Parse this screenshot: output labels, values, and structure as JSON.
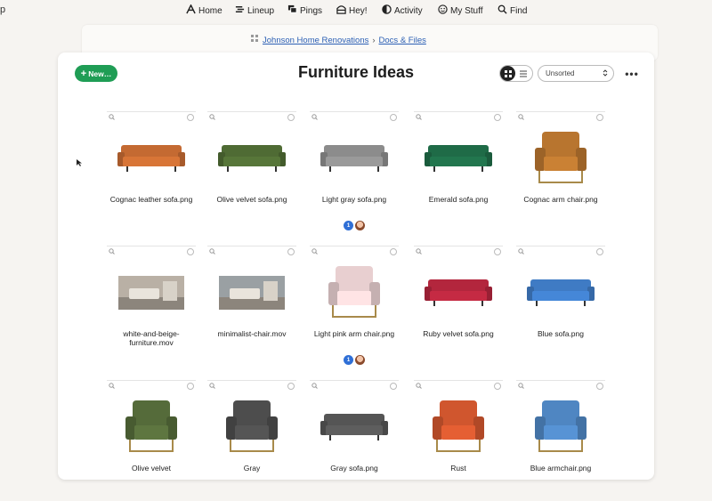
{
  "brand": "p",
  "nav": [
    {
      "label": "Home",
      "icon": "home-icon"
    },
    {
      "label": "Lineup",
      "icon": "lineup-icon"
    },
    {
      "label": "Pings",
      "icon": "pings-icon"
    },
    {
      "label": "Hey!",
      "icon": "hey-icon"
    },
    {
      "label": "Activity",
      "icon": "activity-icon"
    },
    {
      "label": "My Stuff",
      "icon": "my-stuff-icon"
    },
    {
      "label": "Find",
      "icon": "find-icon"
    }
  ],
  "breadcrumb": {
    "project": "Johnson Home Renovations",
    "separator": "›",
    "section": "Docs & Files"
  },
  "toolbar": {
    "new_label": "New…",
    "title": "Furniture Ideas",
    "sort_value": "Unsorted",
    "more_label": "•••"
  },
  "tiles": [
    {
      "name": "Cognac leather sofa.png",
      "kind": "sofa",
      "color": "#c46a32"
    },
    {
      "name": "Olive velvet sofa.png",
      "kind": "sofa",
      "color": "#4f6b34"
    },
    {
      "name": "Light gray sofa.png",
      "kind": "sofa",
      "color": "#8c8c8c",
      "comments": "1"
    },
    {
      "name": "Emerald sofa.png",
      "kind": "sofa",
      "color": "#1f6b47"
    },
    {
      "name": "Cognac arm chair.png",
      "kind": "armchair",
      "color": "#b8752f"
    },
    {
      "name": "white-and-beige-furniture.mov",
      "kind": "photo",
      "color": "#b9b0a5"
    },
    {
      "name": "minimalist-chair.mov",
      "kind": "photo",
      "color": "#9aa0a3"
    },
    {
      "name": "Light pink arm chair.png",
      "kind": "armchair",
      "color": "#e8cfd0",
      "comments": "1"
    },
    {
      "name": "Ruby velvet sofa.png",
      "kind": "sofa",
      "color": "#b3263d"
    },
    {
      "name": "Blue sofa.png",
      "kind": "sofa",
      "color": "#3f7bc4"
    },
    {
      "name": "Olive velvet",
      "kind": "armchair",
      "color": "#556b3a"
    },
    {
      "name": "Gray",
      "kind": "armchair",
      "color": "#4d4d4d"
    },
    {
      "name": "Gray sofa.png",
      "kind": "sofa",
      "color": "#555555"
    },
    {
      "name": "Rust",
      "kind": "armchair",
      "color": "#d0562e"
    },
    {
      "name": "Blue armchair.png",
      "kind": "armchair",
      "color": "#4f86c2"
    }
  ],
  "colors": {
    "accent": "#1f9d55",
    "link": "#2b5fb4",
    "badge": "#2f6fd6"
  }
}
